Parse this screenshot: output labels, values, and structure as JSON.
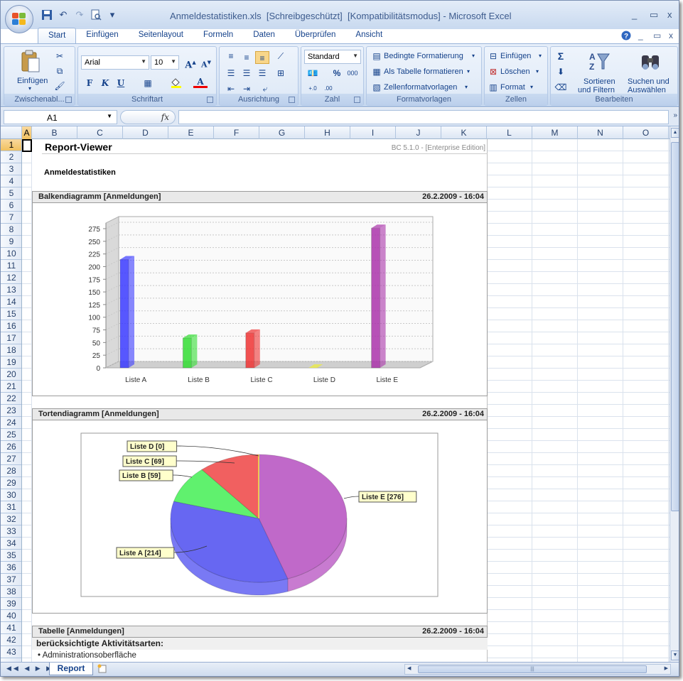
{
  "window": {
    "title": "Anmeldestatistiken.xls  [Schreibgeschützt]  [Kompatibilitätsmodus] - Microsoft Excel",
    "minimize": "_",
    "maximize": "▭",
    "close": "x"
  },
  "quick_access": {
    "customize": "▾"
  },
  "tabs": [
    "Start",
    "Einfügen",
    "Seitenlayout",
    "Formeln",
    "Daten",
    "Überprüfen",
    "Ansicht"
  ],
  "ribbon": {
    "clipboard": {
      "label": "Zwischenabl...",
      "paste": "Einfügen"
    },
    "font": {
      "label": "Schriftart",
      "name": "Arial",
      "size": "10",
      "bold": "F",
      "italic": "K",
      "underline": "U"
    },
    "alignment": {
      "label": "Ausrichtung"
    },
    "number": {
      "label": "Zahl",
      "format": "Standard",
      "percent": "%",
      "thousands": "000"
    },
    "styles": {
      "label": "Formatvorlagen",
      "conditional": "Bedingte Formatierung",
      "as_table": "Als Tabelle formatieren",
      "cell_styles": "Zellenformatvorlagen"
    },
    "cells": {
      "label": "Zellen",
      "insert": "Einfügen",
      "delete": "Löschen",
      "format": "Format"
    },
    "editing": {
      "label": "Bearbeiten",
      "sum": "Σ",
      "sort_line1": "Sortieren",
      "sort_line2": "und Filtern",
      "find_line1": "Suchen und",
      "find_line2": "Auswählen"
    }
  },
  "formula_bar": {
    "name_box": "A1",
    "fx": "fx",
    "value": ""
  },
  "columns": [
    "A",
    "B",
    "C",
    "D",
    "E",
    "F",
    "G",
    "H",
    "I",
    "J",
    "K",
    "L",
    "M",
    "N",
    "O"
  ],
  "rows": [
    "1",
    "2",
    "3",
    "4",
    "5",
    "6",
    "7",
    "8",
    "9",
    "10",
    "11",
    "12",
    "13",
    "14",
    "15",
    "16",
    "17",
    "18",
    "19",
    "20",
    "21",
    "22",
    "23",
    "24",
    "25",
    "26",
    "27",
    "28",
    "29",
    "30",
    "31",
    "32",
    "33",
    "34",
    "35",
    "36",
    "37",
    "38",
    "39",
    "40",
    "41",
    "42",
    "43"
  ],
  "report": {
    "title": "Report-Viewer",
    "edition": "BC 5.1.0 - [Enterprise Edition]",
    "subtitle": "Anmeldestatistiken",
    "bar_section": {
      "title": "Balkendiagramm [Anmeldungen]",
      "date": "26.2.2009 - 16:04"
    },
    "pie_section": {
      "title": "Tortendiagramm [Anmeldungen]",
      "date": "26.2.2009 - 16:04"
    },
    "table_section": {
      "title": "Tabelle [Anmeldungen]",
      "date": "26.2.2009 - 16:04",
      "subheading": "berücksichtigte Aktivitätsarten:",
      "item": "• Administrationsoberfläche"
    }
  },
  "chart_data": [
    {
      "type": "bar",
      "categories": [
        "Liste A",
        "Liste B",
        "Liste C",
        "Liste D",
        "Liste E"
      ],
      "values": [
        214,
        59,
        69,
        0,
        276
      ],
      "colors": [
        "#3a3aff",
        "#33dd33",
        "#ee3333",
        "#eeee33",
        "#aa33aa"
      ],
      "ylim": [
        0,
        275
      ],
      "yticks": [
        "0",
        "25",
        "50",
        "75",
        "100",
        "125",
        "150",
        "175",
        "200",
        "225",
        "250",
        "275"
      ],
      "grid": true
    },
    {
      "type": "pie",
      "categories": [
        "Liste A",
        "Liste B",
        "Liste C",
        "Liste D",
        "Liste E"
      ],
      "values": [
        214,
        59,
        69,
        0,
        276
      ],
      "labels": [
        "Liste A [214]",
        "Liste B [59]",
        "Liste C [69]",
        "Liste D [0]",
        "Liste E [276]"
      ],
      "colors": [
        "#4c4cf0",
        "#44ee55",
        "#ee4444",
        "#eeee44",
        "#b54fc0"
      ]
    }
  ],
  "sheets": {
    "active": "Report"
  }
}
